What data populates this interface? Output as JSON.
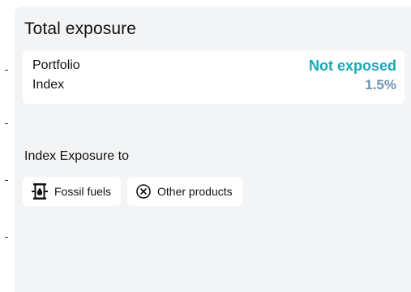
{
  "panel": {
    "title": "Total exposure"
  },
  "exposure": {
    "rows": [
      {
        "label": "Portfolio",
        "value": "Not exposed"
      },
      {
        "label": "Index",
        "value": "1.5%"
      }
    ]
  },
  "index_exposure": {
    "title": "Index Exposure to",
    "chips": [
      {
        "label": "Fossil fuels",
        "icon": "oil-barrel-icon"
      },
      {
        "label": "Other products",
        "icon": "circle-x-icon"
      }
    ]
  },
  "colors": {
    "portfolio_value": "#17a9b7",
    "index_value": "#6f93b1",
    "panel_background": "#f3f4f6"
  }
}
